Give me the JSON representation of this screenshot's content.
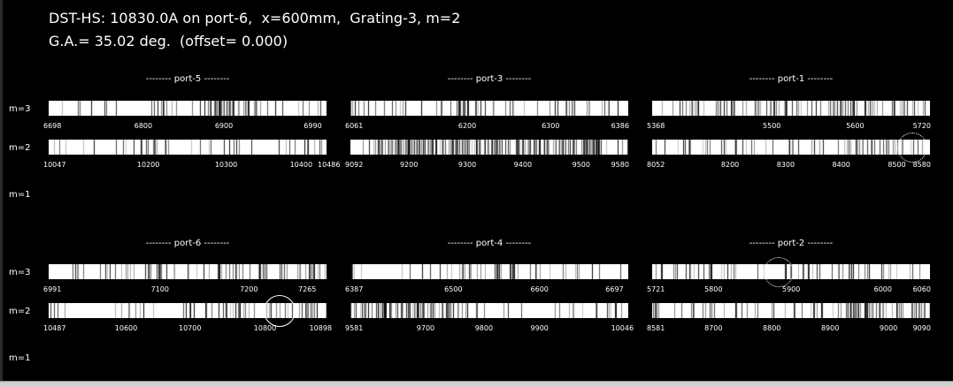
{
  "header": {
    "line1": "DST-HS: 10830.0A on port-6,  x=600mm,  Grating-3, m=2",
    "line2": "G.A.= 35.02 deg.  (offset= 0.000)"
  },
  "order_labels": {
    "m3": "m=3",
    "m2": "m=2",
    "m1": "m=1"
  },
  "panels": [
    {
      "title": "-------- port-5 --------",
      "m3": {
        "ticks": [
          "6698",
          "6800",
          "6900",
          "6990"
        ]
      },
      "m2": {
        "ticks": [
          "10047",
          "10200",
          "10300",
          "10400",
          "10486"
        ]
      }
    },
    {
      "title": "-------- port-3 --------",
      "m3": {
        "ticks": [
          "6061",
          "6200",
          "6300",
          "6386"
        ]
      },
      "m2": {
        "ticks": [
          "9092",
          "9200",
          "9300",
          "9400",
          "9500",
          "9580"
        ]
      }
    },
    {
      "title": "-------- port-1 --------",
      "m3": {
        "ticks": [
          "5368",
          "5500",
          "5600",
          "5720"
        ]
      },
      "m2": {
        "ticks": [
          "8052",
          "8200",
          "8300",
          "8400",
          "8500",
          "8580"
        ]
      }
    },
    {
      "title": "-------- port-6 --------",
      "m3": {
        "ticks": [
          "6991",
          "7100",
          "7200",
          "7265"
        ]
      },
      "m2": {
        "ticks": [
          "10487",
          "10600",
          "10700",
          "10800",
          "10898"
        ]
      }
    },
    {
      "title": "-------- port-4 --------",
      "m3": {
        "ticks": [
          "6387",
          "6500",
          "6600",
          "6697"
        ]
      },
      "m2": {
        "ticks": [
          "9581",
          "9700",
          "9800",
          "9900",
          "10046"
        ]
      }
    },
    {
      "title": "-------- port-2 --------",
      "m3": {
        "ticks": [
          "5721",
          "5800",
          "5900",
          "6000",
          "6060"
        ]
      },
      "m2": {
        "ticks": [
          "8581",
          "8700",
          "8800",
          "8900",
          "9000",
          "9090"
        ]
      }
    }
  ],
  "colors": {
    "background": "#000000",
    "text": "#ffffff",
    "strip": "#ffffff",
    "lines": "#000000"
  }
}
